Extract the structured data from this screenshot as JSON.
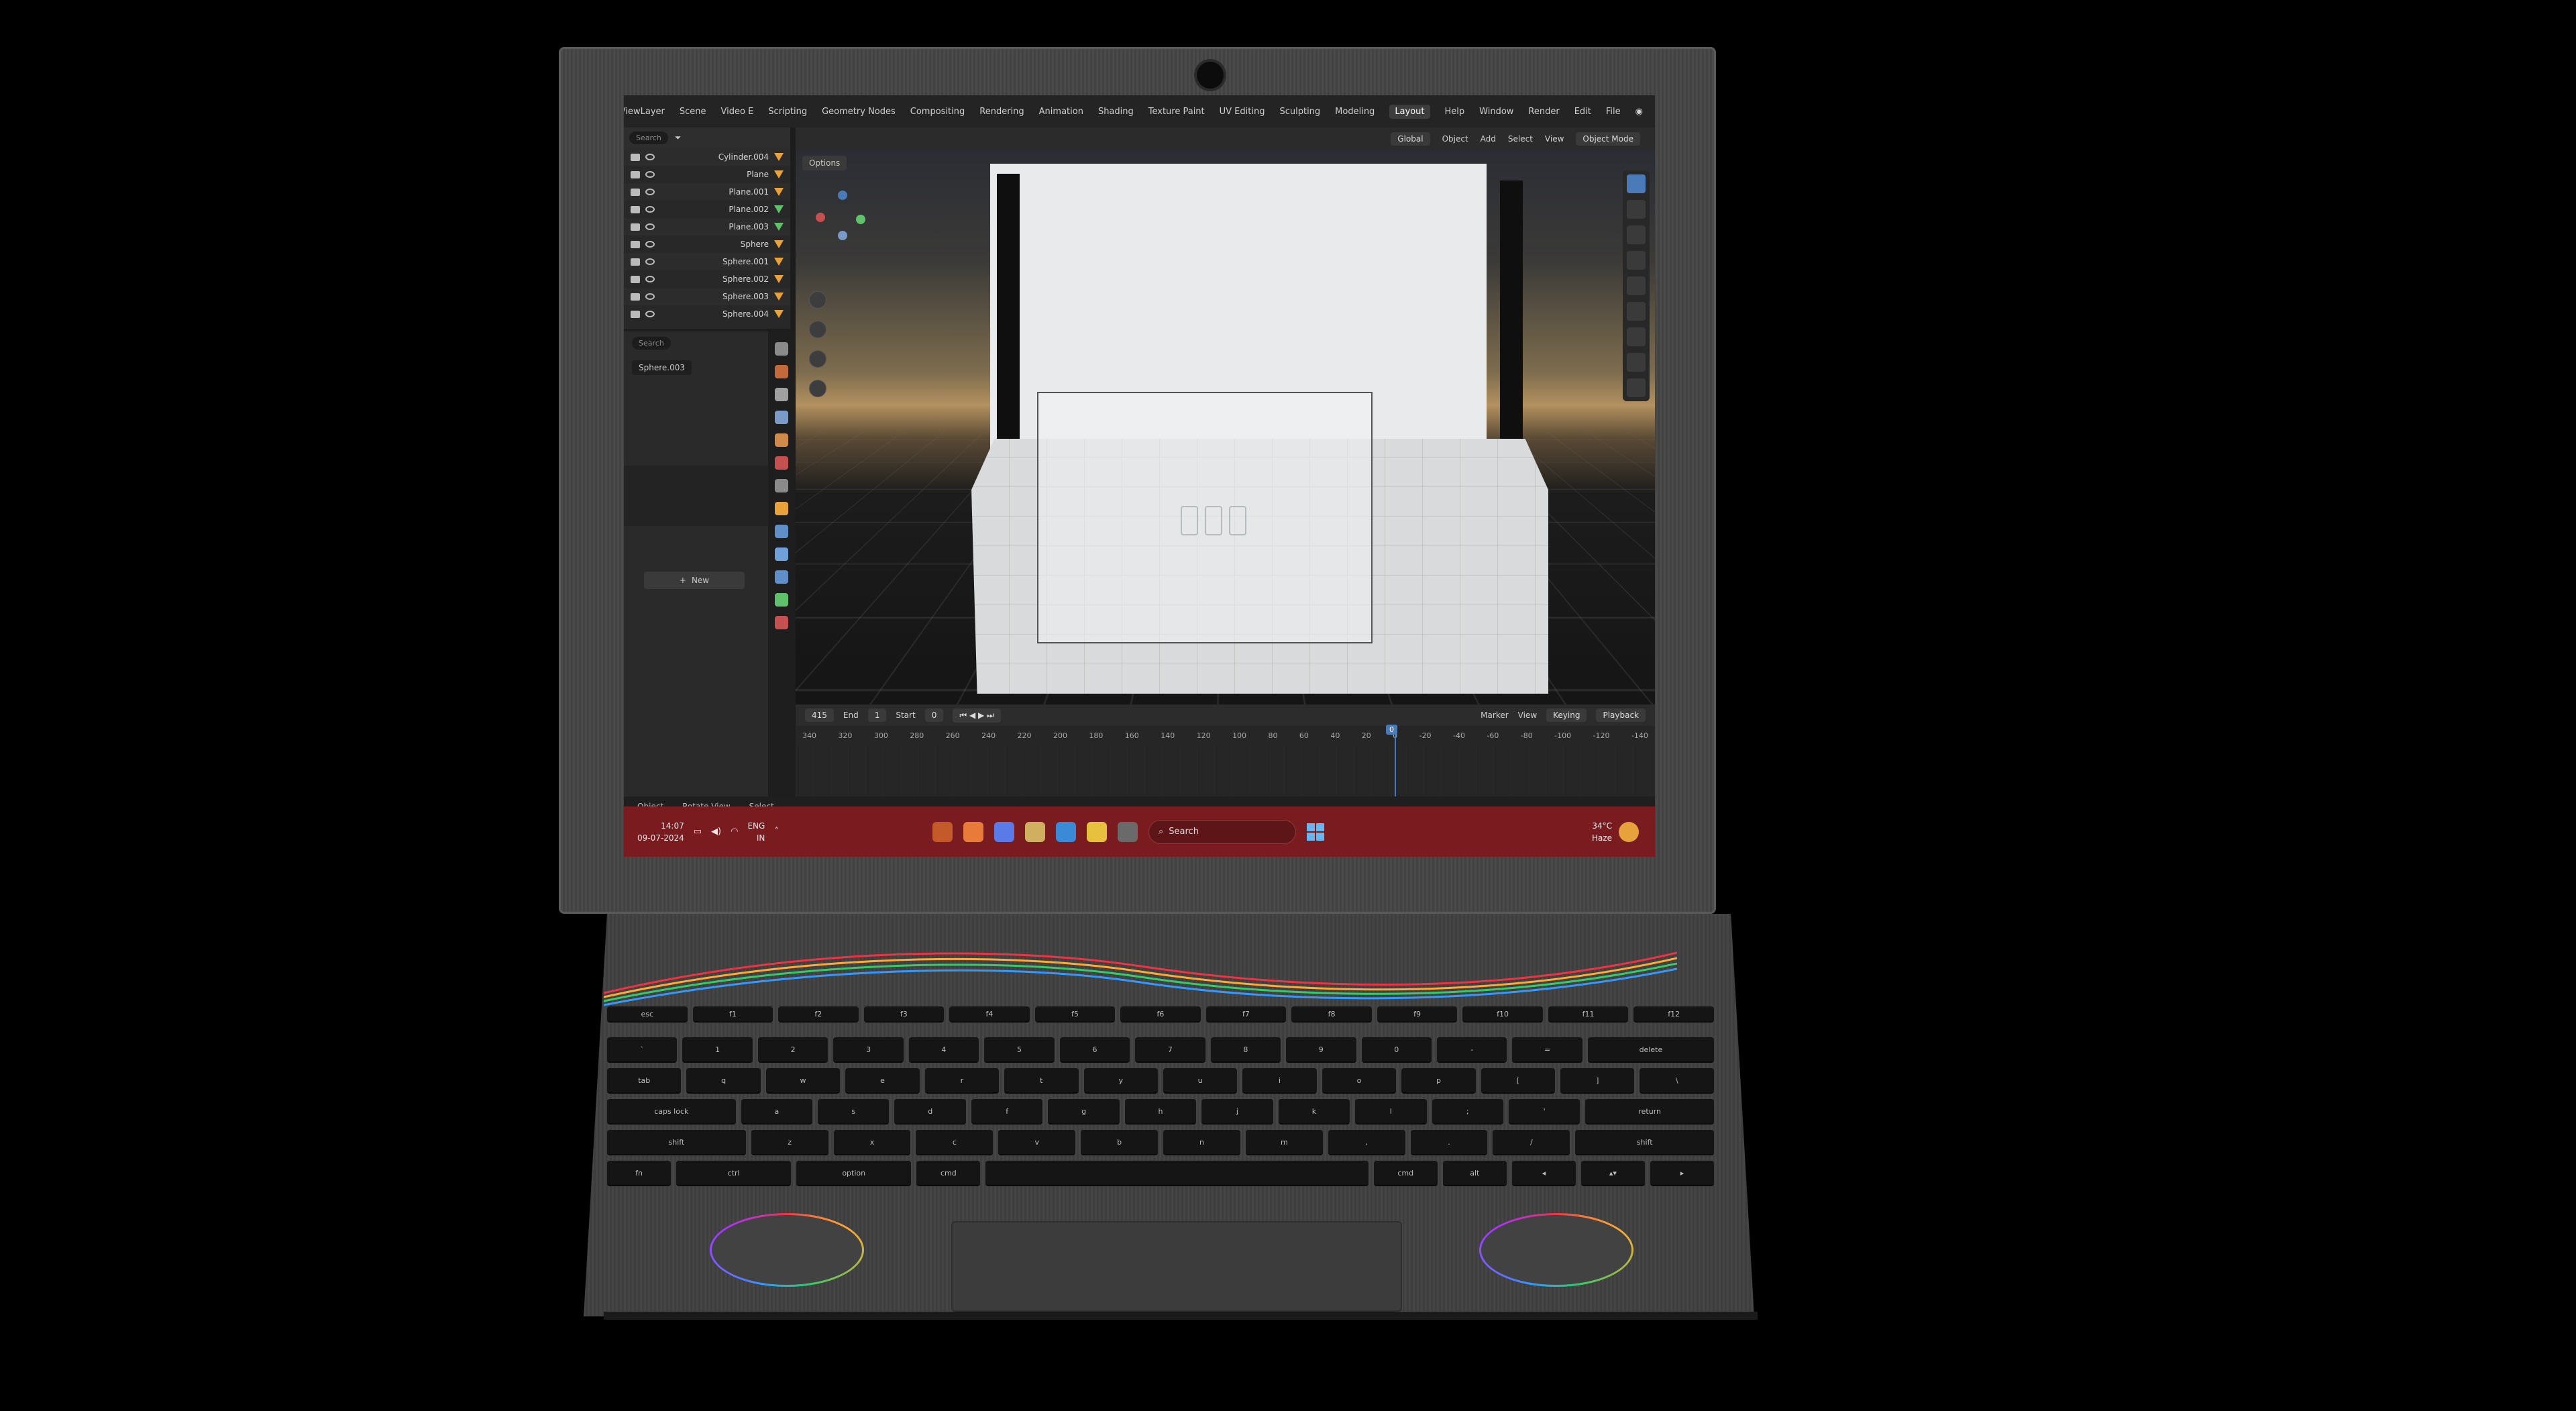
{
  "blender": {
    "menu": [
      "File",
      "Edit",
      "Render",
      "Window",
      "Help"
    ],
    "workspaces": [
      "Layout",
      "Modeling",
      "Sculpting",
      "UV Editing",
      "Texture Paint",
      "Shading",
      "Animation",
      "Rendering",
      "Compositing",
      "Geometry Nodes",
      "Scripting",
      "Video E"
    ],
    "active_workspace": "Layout",
    "scene_label": "Scene",
    "viewlayer_label": "ViewLayer",
    "header": {
      "mode": "Object Mode",
      "menus": [
        "View",
        "Select",
        "Add",
        "Object"
      ],
      "transform_orientation": "Global"
    },
    "outliner": {
      "search_placeholder": "Search",
      "items": [
        "Cylinder.004",
        "Plane",
        "Plane.001",
        "Plane.002",
        "Plane.003",
        "Sphere",
        "Sphere.001",
        "Sphere.002",
        "Sphere.003",
        "Sphere.004"
      ]
    },
    "properties": {
      "search_placeholder": "Search",
      "object_name": "Sphere.003",
      "new_button": "New"
    },
    "viewport": {
      "options_label": "Options"
    },
    "timeline": {
      "menus": [
        "Playback",
        "Keying",
        "View",
        "Marker"
      ],
      "current_frame": "0",
      "start_label": "Start",
      "start_value": "1",
      "end_label": "End",
      "end_value": "415",
      "ruler": [
        "340",
        "320",
        "300",
        "280",
        "260",
        "240",
        "220",
        "200",
        "180",
        "160",
        "140",
        "120",
        "100",
        "80",
        "60",
        "40",
        "20",
        "0",
        "-20",
        "-40",
        "-60",
        "-80",
        "-100",
        "-120",
        "-140"
      ],
      "playhead_label": "0"
    },
    "statusbar": [
      "Select",
      "Rotate View",
      "Object"
    ]
  },
  "taskbar": {
    "temperature": "34°C",
    "weather": "Haze",
    "search_placeholder": "Search",
    "language": "ENG",
    "region": "IN",
    "time": "14:07",
    "date": "09-07-2024",
    "accent": "#7a1c1f"
  },
  "keyboard": {
    "fn_row": [
      "esc",
      "f1",
      "f2",
      "f3",
      "f4",
      "f5",
      "f6",
      "f7",
      "f8",
      "f9",
      "f10",
      "f11",
      "f12"
    ],
    "num_row": [
      "`",
      "1",
      "2",
      "3",
      "4",
      "5",
      "6",
      "7",
      "8",
      "9",
      "0",
      "-",
      "=",
      "delete"
    ],
    "row2": [
      "tab",
      "q",
      "w",
      "e",
      "r",
      "t",
      "y",
      "u",
      "i",
      "o",
      "p",
      "[",
      "]",
      "\\"
    ],
    "row3": [
      "caps lock",
      "a",
      "s",
      "d",
      "f",
      "g",
      "h",
      "j",
      "k",
      "l",
      ";",
      "'",
      "return"
    ],
    "row4": [
      "shift",
      "z",
      "x",
      "c",
      "v",
      "b",
      "n",
      "m",
      ",",
      ".",
      "/",
      "shift"
    ],
    "row5": [
      "fn",
      "ctrl",
      "option",
      "cmd",
      "",
      "cmd",
      "alt",
      "◂",
      "▴▾",
      "▸"
    ]
  }
}
